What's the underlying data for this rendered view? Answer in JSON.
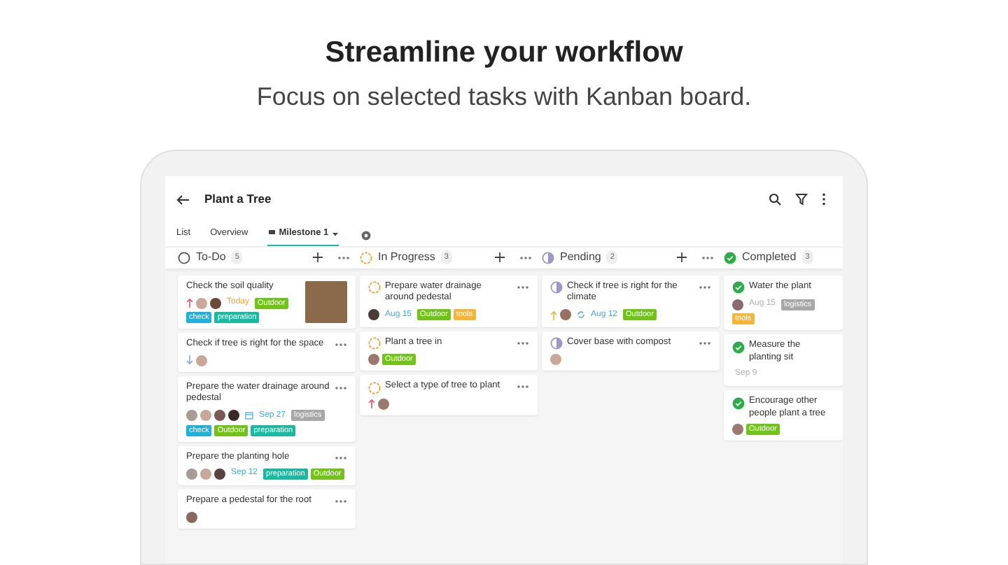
{
  "heading": "Streamline your workflow",
  "subheading": "Focus on selected tasks with Kanban board.",
  "project": {
    "title": "Plant a Tree"
  },
  "tabs": [
    {
      "label": "List",
      "selected": false,
      "kind": "plain"
    },
    {
      "label": "Overview",
      "selected": false,
      "kind": "plain"
    },
    {
      "label": "Milestone 1",
      "selected": true,
      "kind": "milestone"
    }
  ],
  "columns": [
    {
      "title": "To-Do",
      "count": "5",
      "kind": "todo",
      "cards": [
        {
          "title": "Check the soil quality",
          "priority": {
            "kind": "high"
          },
          "assignees": [
            {
              "color": "#c9a899"
            },
            {
              "color": "#6b4a3c"
            }
          ],
          "date": {
            "text": "Today",
            "kind": "today"
          },
          "tags": [
            {
              "label": "Outdoor",
              "color": "#72c21b"
            },
            {
              "label": "check",
              "color": "#1fb1da"
            },
            {
              "label": "preparation",
              "color": "#1db8a1"
            }
          ],
          "photo": true
        },
        {
          "title": "Check if tree is right for the space",
          "priority": {
            "kind": "low"
          },
          "assignees": [
            {
              "color": "#c9a899"
            }
          ]
        },
        {
          "title": "Prepare the water drainage around pedestal",
          "assignees": [
            {
              "color": "#a89a95"
            },
            {
              "color": "#c9a899"
            },
            {
              "color": "#7a5a55"
            },
            {
              "color": "#3a2a2a"
            }
          ],
          "date": {
            "text": "Sep 27",
            "kind": "calendar"
          },
          "tags": [
            {
              "label": "logistics",
              "color": "#a7a7a7"
            },
            {
              "label": "check",
              "color": "#1fb1da"
            },
            {
              "label": "Outdoor",
              "color": "#72c21b"
            },
            {
              "label": "preparation",
              "color": "#1db8a1"
            }
          ]
        },
        {
          "title": "Prepare the planting hole",
          "assignees": [
            {
              "color": "#a89a95"
            },
            {
              "color": "#c9a899"
            },
            {
              "color": "#5a4040"
            }
          ],
          "date": {
            "text": "Sep 12",
            "kind": "due"
          },
          "tags": [
            {
              "label": "preparation",
              "color": "#1db8a1"
            },
            {
              "label": "Outdoor",
              "color": "#72c21b"
            }
          ]
        },
        {
          "title": "Prepare a pedestal for the root",
          "assignees": [
            {
              "color": "#8a6a60"
            }
          ]
        }
      ]
    },
    {
      "title": "In Progress",
      "count": "3",
      "kind": "progress",
      "cards": [
        {
          "title": "Prepare water drainage around pedestal",
          "assignees": [
            {
              "color": "#4a3a3a"
            }
          ],
          "date": {
            "text": "Aug 15",
            "kind": "due"
          },
          "tags": [
            {
              "label": "Outdoor",
              "color": "#72c21b"
            },
            {
              "label": "tools",
              "color": "#f5b53a"
            }
          ]
        },
        {
          "title": "Plant a tree in",
          "assignees": [
            {
              "color": "#9a7a70"
            }
          ],
          "tags": [
            {
              "label": "Outdoor",
              "color": "#72c21b"
            }
          ]
        },
        {
          "title": "Select a type of tree to plant",
          "priority": {
            "kind": "high"
          },
          "assignees": [
            {
              "color": "#9a7a70"
            }
          ]
        }
      ]
    },
    {
      "title": "Pending",
      "count": "2",
      "kind": "pending",
      "cards": [
        {
          "title": "Check if tree is right for the climate",
          "priority": {
            "kind": "medium"
          },
          "assignees": [
            {
              "color": "#9a7060"
            }
          ],
          "date": {
            "text": "Aug 12",
            "kind": "repeat"
          },
          "tags": [
            {
              "label": "Outdoor",
              "color": "#72c21b"
            }
          ]
        },
        {
          "title": "Cover base with compost",
          "assignees": [
            {
              "color": "#c9a899"
            }
          ]
        }
      ]
    },
    {
      "title": "Completed",
      "count": "3",
      "kind": "done",
      "cards": [
        {
          "title": "Water the plant",
          "assignees": [
            {
              "color": "#8a6a70"
            }
          ],
          "date": {
            "text": "Aug 15",
            "kind": "done"
          },
          "tags": [
            {
              "label": "logistics",
              "color": "#a7a7a7"
            },
            {
              "label": "tools",
              "color": "#f5b53a"
            }
          ]
        },
        {
          "title": "Measure the planting sit",
          "date": {
            "text": "Sep 9",
            "kind": "done"
          }
        },
        {
          "title": "Encourage other people plant a tree",
          "assignees": [
            {
              "color": "#9a7a70"
            }
          ],
          "tags": [
            {
              "label": "Outdoor",
              "color": "#72c21b"
            }
          ]
        }
      ]
    }
  ]
}
